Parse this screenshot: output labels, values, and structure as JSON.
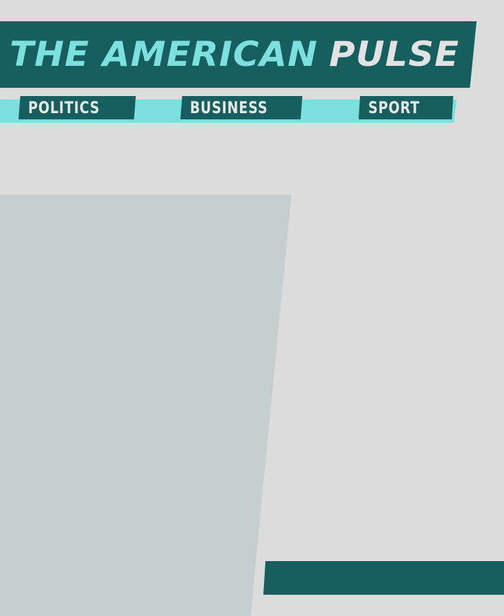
{
  "masthead": {
    "title_part1": "THE AMERICAN",
    "title_part2": "PULSE"
  },
  "nav": {
    "items": [
      {
        "label": "POLITICS"
      },
      {
        "label": "BUSINESS"
      },
      {
        "label": "SPORT"
      }
    ]
  },
  "colors": {
    "background": "#dcdcdc",
    "dark_teal": "#175e5f",
    "light_cyan": "#7ce0de",
    "panel_gray": "#c5cfce",
    "light_text": "#e2e2e2"
  }
}
